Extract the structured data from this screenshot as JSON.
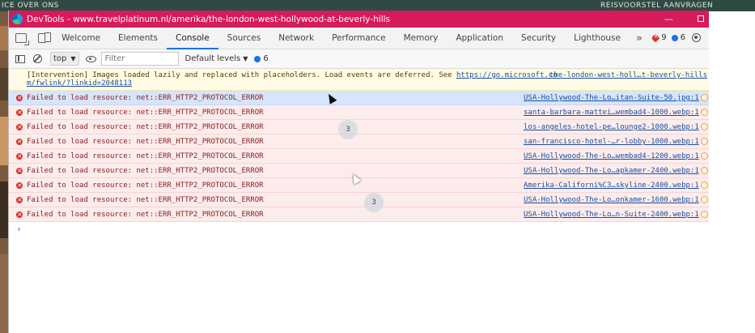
{
  "background": {
    "nav_left": "ICE OVER ONS",
    "nav_right": "REISVOORSTEL AANVRAGEN"
  },
  "window": {
    "title": "DevTools - www.travelplatinum.nl/amerika/the-london-west-hollywood-at-beverly-hills",
    "minimize": "—"
  },
  "tabs": [
    "Welcome",
    "Elements",
    "Console",
    "Sources",
    "Network",
    "Performance",
    "Memory",
    "Application",
    "Security",
    "Lighthouse"
  ],
  "tabs_more": "»",
  "tabs_add": "+",
  "counts": {
    "errors": "9",
    "issues": "6"
  },
  "toolbar": {
    "context": "top",
    "filter_placeholder": "Filter",
    "levels": "Default levels",
    "issues_count": "6"
  },
  "intervention": {
    "text": "[Intervention] Images loaded lazily and replaced with placeholders. Load events are deferred. See ",
    "link": "https://go.microsoft.co",
    "link_cont": "m/fwlink/?linkid=2048113",
    "source": "the-london-west-holl…t-beverly-hills"
  },
  "errors": [
    {
      "message": "Failed to load resource: net::ERR_HTTP2_PROTOCOL_ERROR",
      "source": "USA-Hollywood-The-Lo…itan-Suite-50.jpg:1"
    },
    {
      "message": "Failed to load resource: net::ERR_HTTP2_PROTOCOL_ERROR",
      "source": "santa-barbara-mattei…wembad4-1000.webp:1"
    },
    {
      "message": "Failed to load resource: net::ERR_HTTP2_PROTOCOL_ERROR",
      "source": "los-angeles-hotel-pe…lounge2-1000.webp:1"
    },
    {
      "message": "Failed to load resource: net::ERR_HTTP2_PROTOCOL_ERROR",
      "source": "san-francisco-hotel-…r-lobby-1000.webp:1"
    },
    {
      "message": "Failed to load resource: net::ERR_HTTP2_PROTOCOL_ERROR",
      "source": "USA-Hollywood-The-Lo…wembad4-1200.webp:1"
    },
    {
      "message": "Failed to load resource: net::ERR_HTTP2_PROTOCOL_ERROR",
      "source": "USA-Hollywood-The-Lo…apkamer-2400.webp:1"
    },
    {
      "message": "Failed to load resource: net::ERR_HTTP2_PROTOCOL_ERROR",
      "source": "Amerika-Californi%C3…skyline-2400.webp:1"
    },
    {
      "message": "Failed to load resource: net::ERR_HTTP2_PROTOCOL_ERROR",
      "source": "USA-Hollywood-The-Lo…onkamer-1600.webp:1"
    },
    {
      "message": "Failed to load resource: net::ERR_HTTP2_PROTOCOL_ERROR",
      "source": "USA-Hollywood-The-Lo…n-Suite-2400.webp:1"
    }
  ],
  "prompt": "›",
  "badges": [
    "3",
    "3"
  ]
}
